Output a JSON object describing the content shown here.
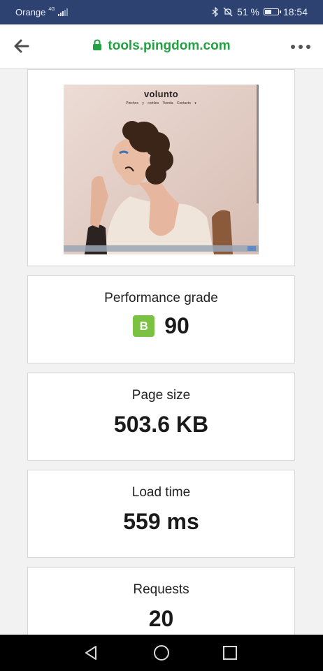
{
  "status_bar": {
    "carrier": "Orange",
    "network": "4G",
    "battery_text": "51 %",
    "battery_level": 0.51,
    "time": "18:54"
  },
  "browser": {
    "url": "tools.pingdom.com",
    "back_icon": "arrow-left-icon",
    "lock_icon": "lock-icon",
    "menu_icon": "more-horizontal-icon"
  },
  "preview": {
    "site_logo": "volunto",
    "nav_items": [
      "Pinchos y cortiles",
      "Tienda",
      "Contacto",
      "▾"
    ]
  },
  "metrics": {
    "performance": {
      "label": "Performance grade",
      "grade": "B",
      "score": "90"
    },
    "page_size": {
      "label": "Page size",
      "value": "503.6 KB"
    },
    "load_time": {
      "label": "Load time",
      "value": "559 ms"
    },
    "requests": {
      "label": "Requests",
      "value": "20"
    }
  },
  "colors": {
    "status_bar": "#2d4270",
    "url_green": "#23a243",
    "grade_b": "#7cc242"
  }
}
